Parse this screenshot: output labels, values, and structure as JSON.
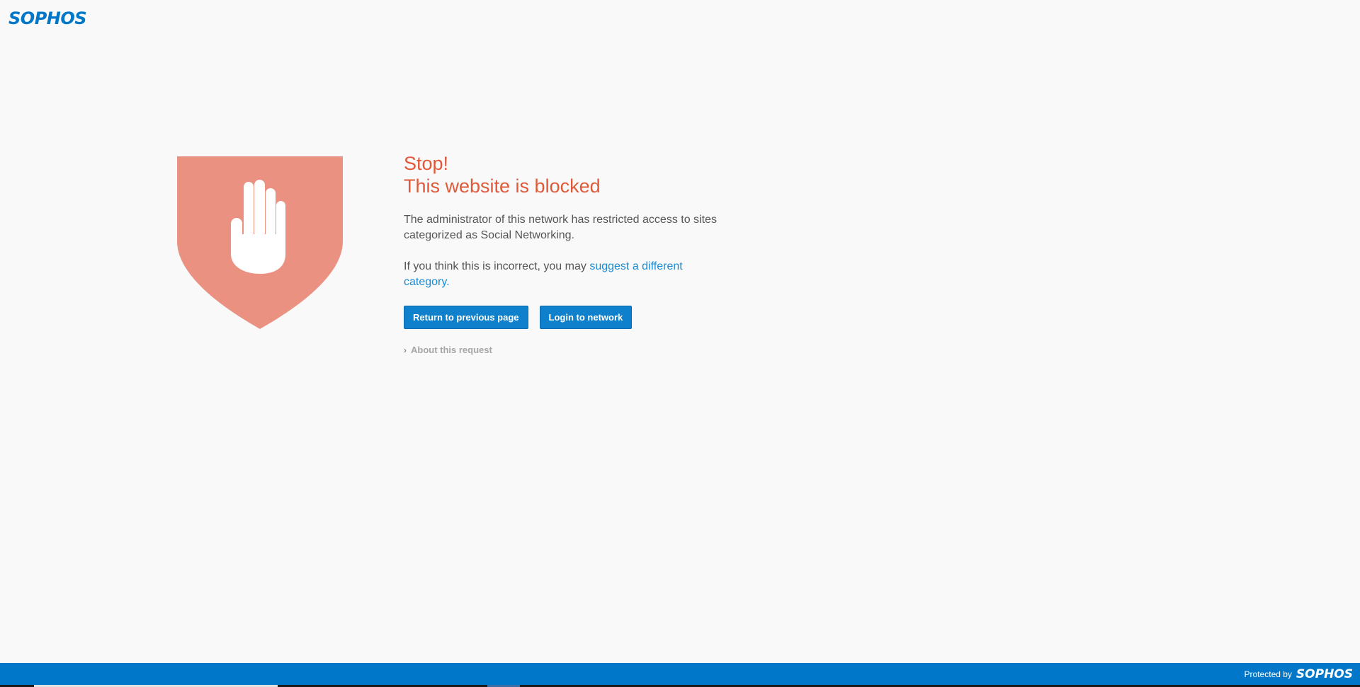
{
  "header": {
    "logo_text": "SOPHOS"
  },
  "block": {
    "icon": "hand-stop-shield-icon",
    "title_line1": "Stop!",
    "title_line2": "This website is blocked",
    "message1": "The administrator of this network has restricted access to sites categorized as Social Networking.",
    "message2_prefix": "If you think this is incorrect, you may ",
    "message2_link": "suggest a different category.",
    "buttons": {
      "return_label": "Return to previous page",
      "login_label": "Login to network"
    },
    "about_label": "About this request"
  },
  "footer": {
    "protected_by": "Protected by",
    "logo_text": "SOPHOS"
  },
  "colors": {
    "brand_blue": "#0077c8",
    "title_red": "#e05a3a",
    "shield_fill": "#ea9182",
    "page_bg": "#f9f9f9",
    "link_blue": "#1a8bd0"
  }
}
